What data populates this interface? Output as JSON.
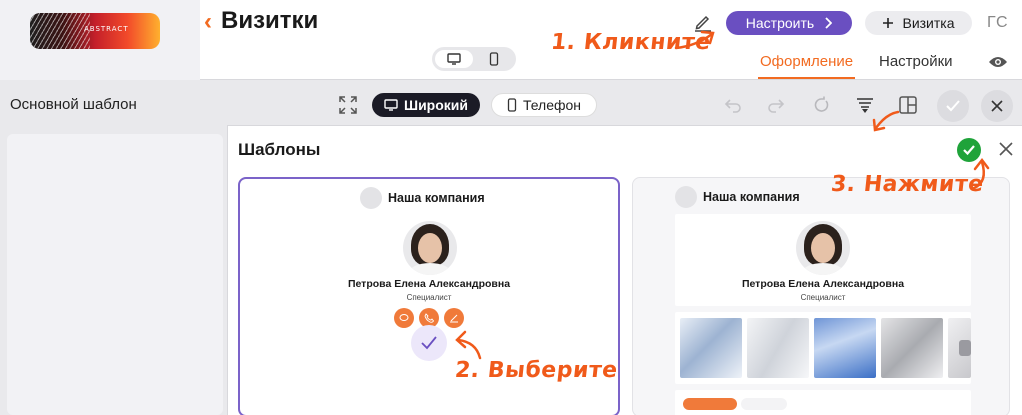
{
  "logo": {
    "text": "ABSTRACT"
  },
  "header": {
    "back_label": "‹",
    "title": "Визитки",
    "configure_label": "Настроить",
    "add_card_label": "Визитка",
    "user_initials": "ГС",
    "tabs": [
      {
        "label": "Оформление",
        "active": true
      },
      {
        "label": "Настройки",
        "active": false
      }
    ]
  },
  "toolbar": {
    "template_label": "Основной шаблон",
    "wide_label": "Широкий",
    "phone_label": "Телефон",
    "active_mode": "wide"
  },
  "modal": {
    "title": "Шаблоны",
    "templates": [
      {
        "company": "Наша компания",
        "name": "Петрова Елена Александровна",
        "role": "Специалист",
        "selected": true
      },
      {
        "company": "Наша компания",
        "name": "Петрова Елена Александровна",
        "role": "Специалист",
        "selected": false
      }
    ]
  },
  "annotations": {
    "step1": "1. Кликните",
    "step2": "2. Выберите",
    "step3": "3. Нажмите"
  },
  "colors": {
    "accent": "#f26b21",
    "primary_button": "#6a4fc1",
    "selected_border": "#7b63c9",
    "confirm": "#1fa33a",
    "annotation": "#f05a1a"
  }
}
